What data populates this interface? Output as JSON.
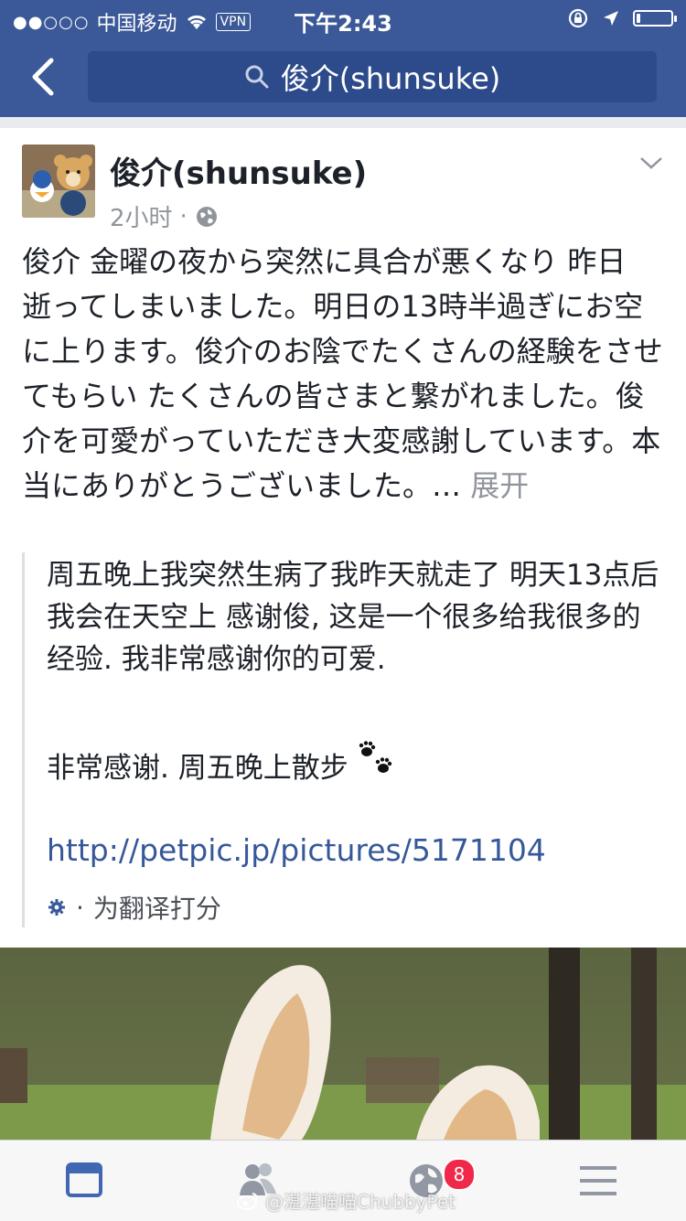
{
  "status_bar": {
    "signal": "●●○○○",
    "carrier": "中国移动",
    "vpn": "VPN",
    "time": "下午2:43"
  },
  "nav": {
    "search_text": "俊介(shunsuke)"
  },
  "post": {
    "author": "俊介(shunsuke)",
    "time_ago": "2小时",
    "separator": "·",
    "body_ja": "俊介 金曜の夜から突然に具合が悪くなり 昨日 逝ってしまいました。明日の13時半過ぎにお空に上ります。俊介のお陰でたくさんの経験をさせてもらい たくさんの皆さまと繋がれました。俊介を可愛がっていただき大変感謝しています。本当にありがとうございました。…",
    "see_more": "展开",
    "translation_p1": "周五晚上我突然生病了我昨天就走了 明天13点后我会在天空上 感谢俊, 这是一个很多给我很多的经验. 我非常感谢你的可爱.",
    "translation_p2": "非常感谢. 周五晚上散步",
    "link": "http://petpic.jp/pictures/5171104",
    "rate_separator": "·",
    "rate_translation": "为翻译打分"
  },
  "tabbar": {
    "notifications_badge": "8"
  },
  "watermark": "@湛湛喵喵ChubbyPet",
  "colors": {
    "nav_bg": "#3b5998",
    "link": "#365899",
    "badge": "#f02849",
    "active_tab": "#4267b2"
  }
}
